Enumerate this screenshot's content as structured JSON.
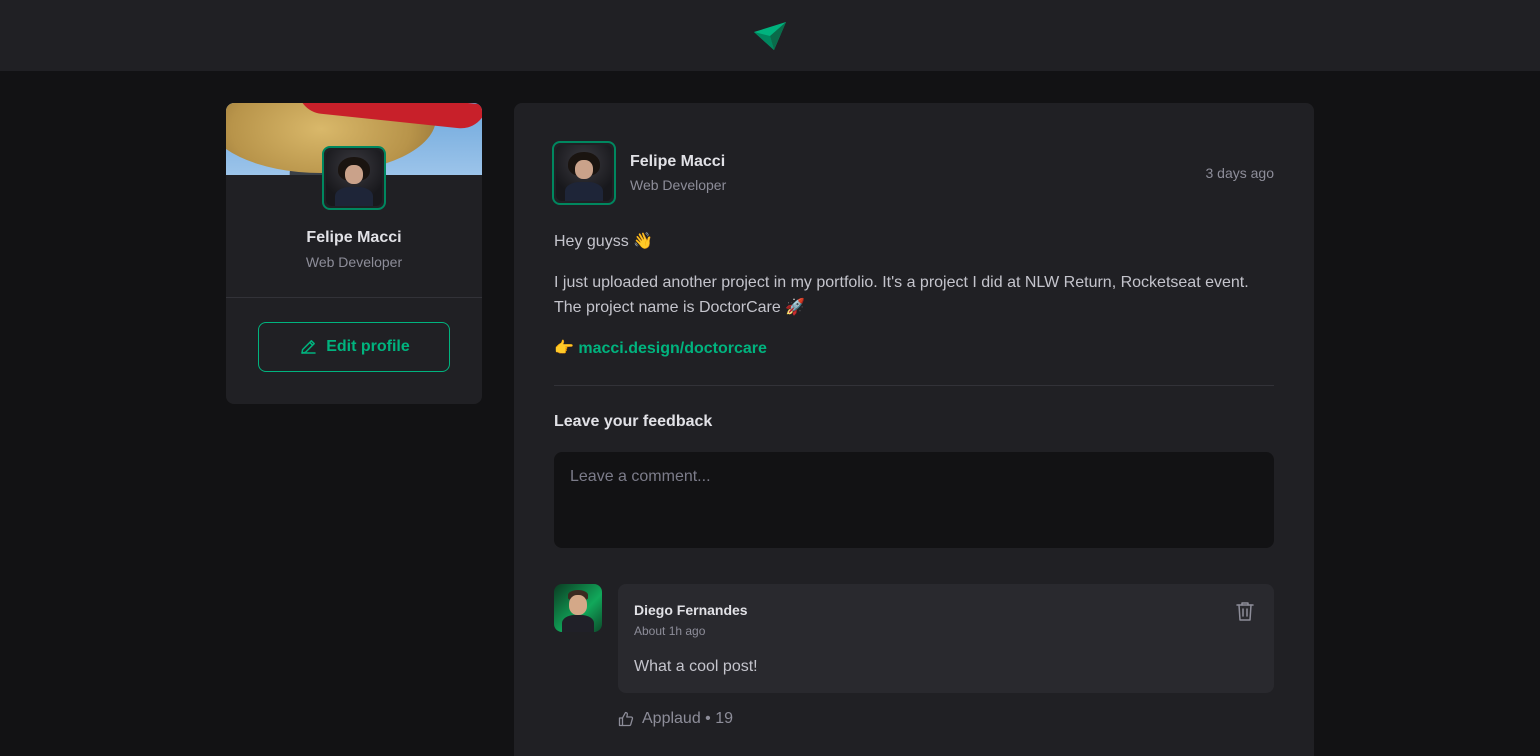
{
  "header": {
    "logo_icon": "paper-plane-logo-icon"
  },
  "sidebar": {
    "name": "Felipe Macci",
    "role": "Web Developer",
    "edit_label": "Edit profile",
    "edit_icon": "pencil-icon"
  },
  "post": {
    "author_name": "Felipe Macci",
    "author_role": "Web Developer",
    "time": "3 days ago",
    "greeting": "Hey guyss 👋",
    "body": "I just uploaded another project in my portfolio. It's a project I did at NLW Return, Rocketseat event. The project name is DoctorCare 🚀",
    "link_prefix": "👉",
    "link_text": "macci.design/doctorcare",
    "feedback_title": "Leave your feedback",
    "comment_placeholder": "Leave a comment..."
  },
  "comment": {
    "author": "Diego Fernandes",
    "time": "About 1h ago",
    "text": "What a cool post!",
    "applaud_label": "Applaud",
    "applaud_count": "19",
    "applaud_text": "Applaud • 19"
  },
  "colors": {
    "accent": "#00b37e",
    "accent_dark": "#00875f",
    "background": "#121214",
    "surface": "#202024"
  }
}
